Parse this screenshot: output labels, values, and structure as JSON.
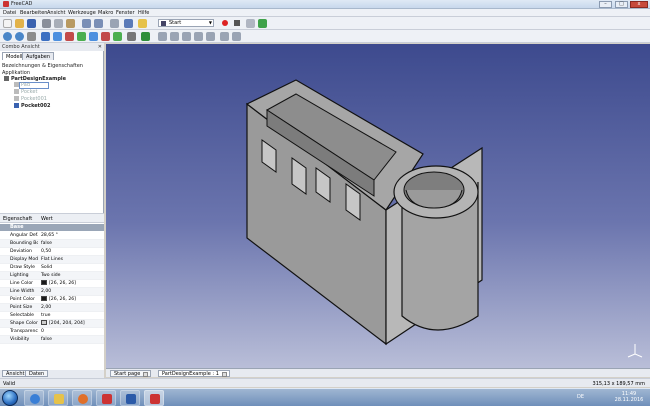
{
  "window": {
    "title": "FreeCAD",
    "controls": {
      "minimize": "–",
      "maximize": "□",
      "close": "x"
    }
  },
  "menu": [
    "Datei",
    "Bearbeiten",
    "Ansicht",
    "Werkzeuge",
    "Makro",
    "Fenster",
    "Hilfe"
  ],
  "toolbar": {
    "workbench": "Start"
  },
  "combo": {
    "title": "Combo Ansicht",
    "tabs": [
      "Modell",
      "Aufgaben"
    ],
    "header": "Bezeichnungen & Eigenschaften",
    "section": "Applikation",
    "tree": [
      {
        "label": "PartDesignExample",
        "style": "bold"
      },
      {
        "label": "Pad",
        "style": "dim"
      },
      {
        "label": "Pocket",
        "style": "dim"
      },
      {
        "label": "Pocket001",
        "style": "dim"
      },
      {
        "label": "Pocket002",
        "style": "bold"
      }
    ]
  },
  "properties": {
    "columns": [
      "Eigenschaft",
      "Wert"
    ],
    "group": "Base",
    "rows": [
      {
        "name": "Angular Def...",
        "value": "28,65 °"
      },
      {
        "name": "Bounding Box",
        "value": "false"
      },
      {
        "name": "Deviation",
        "value": "0,50"
      },
      {
        "name": "Display Mode",
        "value": "Flat Lines"
      },
      {
        "name": "Draw Style",
        "value": "Solid"
      },
      {
        "name": "Lighting",
        "value": "Two side"
      },
      {
        "name": "Line Color",
        "value": "[26, 26, 26]",
        "swatch": "#1a1a1a"
      },
      {
        "name": "Line Width",
        "value": "2,00"
      },
      {
        "name": "Point Color",
        "value": "[26, 26, 26]",
        "swatch": "#1a1a1a"
      },
      {
        "name": "Point Size",
        "value": "2,00"
      },
      {
        "name": "Selectable",
        "value": "true"
      },
      {
        "name": "Shape Color",
        "value": "[204, 204, 204]",
        "swatch": "#cccccc"
      },
      {
        "name": "Transparency",
        "value": "0"
      },
      {
        "name": "Visibility",
        "value": "false"
      }
    ]
  },
  "bottom_tabs": [
    "Ansicht",
    "Daten"
  ],
  "doc_tabs": [
    "Start page",
    "PartDesignExample : 1"
  ],
  "status": {
    "text": "Valid",
    "dimensions": "315,13 x 189,57 mm"
  },
  "taskbar": {
    "language": "DE",
    "time": "11:49",
    "date": "28.11.2016"
  },
  "colors": {
    "viewport_top": "#3d4a8e",
    "viewport_bottom": "#b9bed8",
    "record": "#dd2222"
  }
}
